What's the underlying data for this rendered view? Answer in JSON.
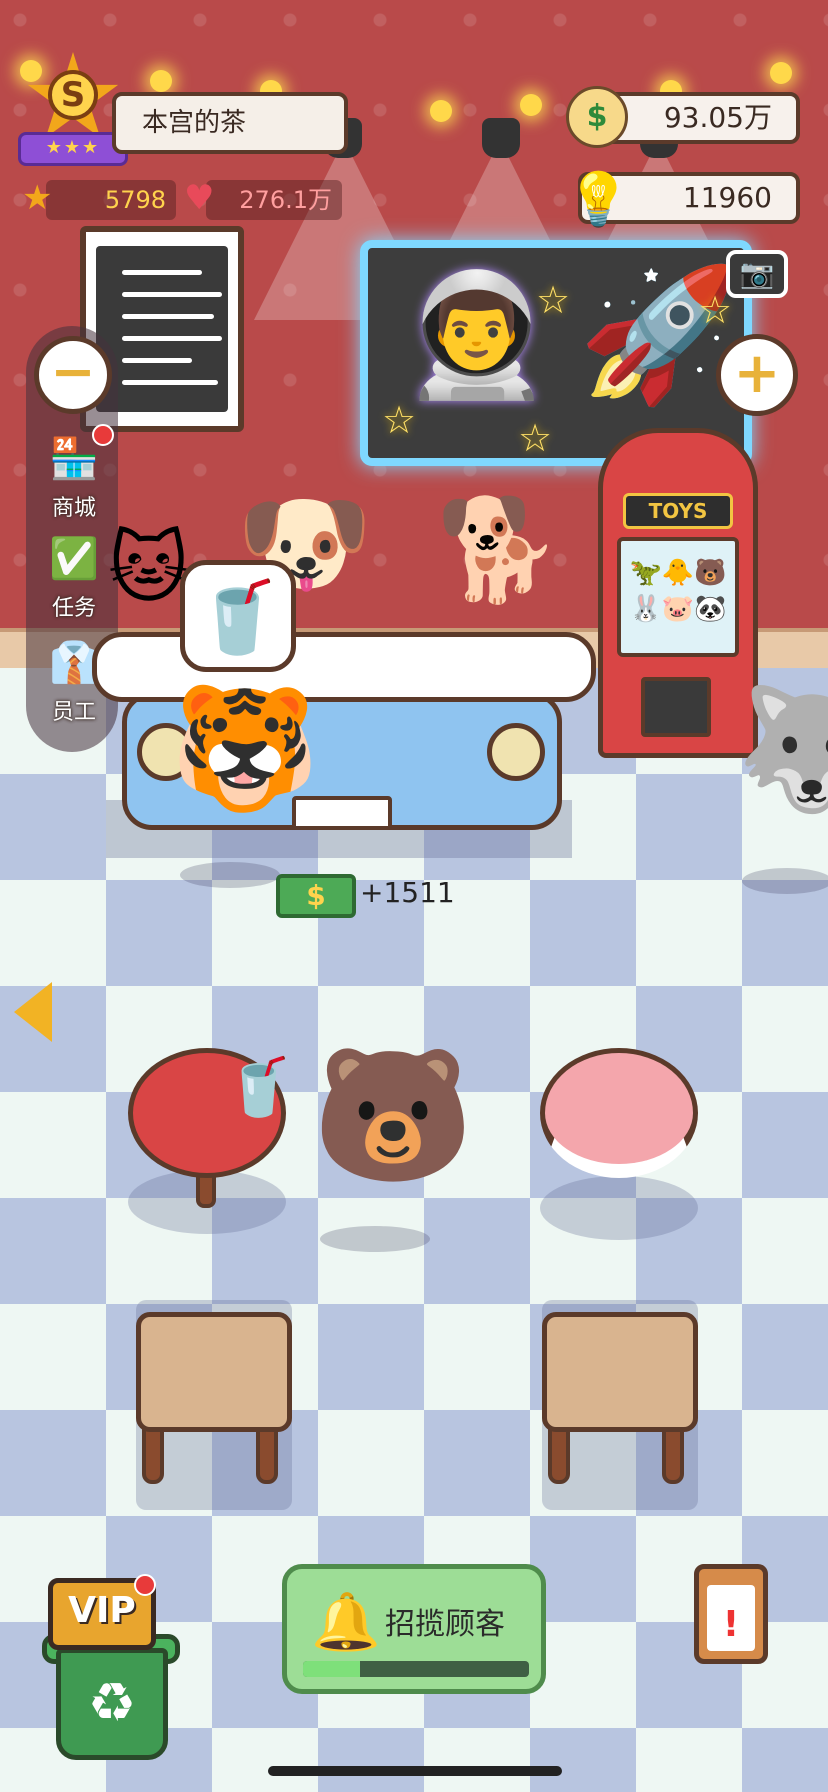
{
  "player": {
    "rank_letter": "S",
    "rank_stars": "★★★",
    "shop_name": "本宫的茶",
    "stars": "5798",
    "popularity": "276.1万"
  },
  "currency": {
    "money": "93.05万",
    "money_symbol": "$",
    "ideas": "11960"
  },
  "side_menu": {
    "zoom_out": "−",
    "zoom_in": "+",
    "items": [
      {
        "label": "商城",
        "icon": "shop-icon",
        "glyph": "🏪",
        "has_dot": true
      },
      {
        "label": "任务",
        "icon": "task-icon",
        "glyph": "✅",
        "has_dot": false
      },
      {
        "label": "员工",
        "icon": "staff-icon",
        "glyph": "👔",
        "has_dot": false
      }
    ]
  },
  "claw_machine": {
    "sign": "TOYS"
  },
  "order": {
    "drink_glyph": "🥤"
  },
  "income": {
    "cash_symbol": "$",
    "amount": "+1511"
  },
  "bottom": {
    "vip_label": "VIP",
    "recruit_label": "招揽顾客",
    "recruit_progress": 0.25
  },
  "colors": {
    "wall": "#b94a4a",
    "floor_light": "#eef7f3",
    "floor_dark": "#b8c5e0",
    "accent_gold": "#f2b324",
    "recruit_green": "#9ddd96"
  }
}
